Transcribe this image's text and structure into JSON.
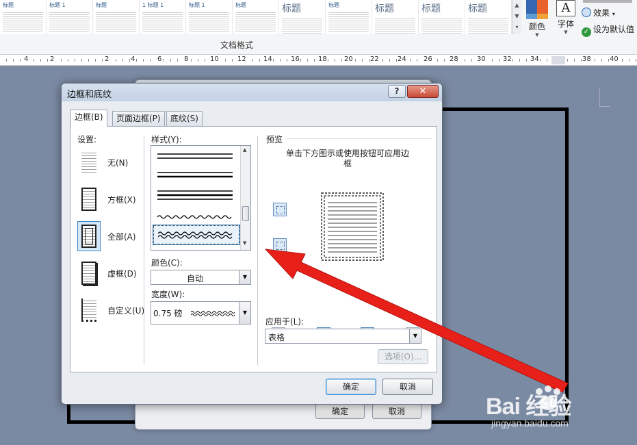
{
  "ribbon": {
    "gallery_thumbs": [
      {
        "title": "标题",
        "big": false
      },
      {
        "title": "标题 1",
        "big": false
      },
      {
        "title": "标题",
        "big": false
      },
      {
        "title": "1 标题 1",
        "big": false
      },
      {
        "title": "标题 1",
        "big": false
      },
      {
        "title": "标题",
        "big": false
      },
      {
        "title": "标题",
        "big": true
      },
      {
        "title": "标题",
        "big": false
      },
      {
        "title": "标题",
        "big": true
      },
      {
        "title": "标题",
        "big": true
      },
      {
        "title": "标题",
        "big": true
      }
    ],
    "gallery_label": "文档格式",
    "colors_label": "颜色",
    "fonts_label": "字体",
    "fonts_glyph": "A",
    "effects_label": "效果",
    "set_default_label": "设为默认值"
  },
  "ruler": {
    "labels": [
      "4",
      "2",
      "2",
      "4",
      "6",
      "8",
      "10",
      "12",
      "14",
      "16",
      "18",
      "20",
      "22",
      "24",
      "26",
      "28",
      "30",
      "32",
      "34",
      "36",
      "38",
      "40"
    ]
  },
  "behind_dialog": {
    "ok": "确定",
    "cancel": "取消"
  },
  "dialog": {
    "title": "边框和底纹",
    "help": "?",
    "close": "✕",
    "tabs": [
      "边框(B)",
      "页面边框(P)",
      "底纹(S)"
    ],
    "settings_label": "设置:",
    "settings": [
      "无(N)",
      "方框(X)",
      "全部(A)",
      "虚框(D)",
      "自定义(U)"
    ],
    "selected_setting": "全部(A)",
    "style_label": "样式(Y):",
    "color_label": "颜色(C):",
    "color_value": "自动",
    "width_label": "宽度(W):",
    "width_value": "0.75 磅",
    "preview_label": "预览",
    "preview_hint": "单击下方图示或使用按钮可应用边框",
    "apply_label": "应用于(L):",
    "apply_value": "表格",
    "options_btn": "选项(O)...",
    "ok": "确定",
    "cancel": "取消"
  },
  "watermark": {
    "main": "Bai  经验",
    "sub": "jingyan.baidu.com"
  },
  "colors": {
    "accent": "#3a86c8",
    "arrow": "#e8201a",
    "document_bg": "#7b8aa3"
  }
}
